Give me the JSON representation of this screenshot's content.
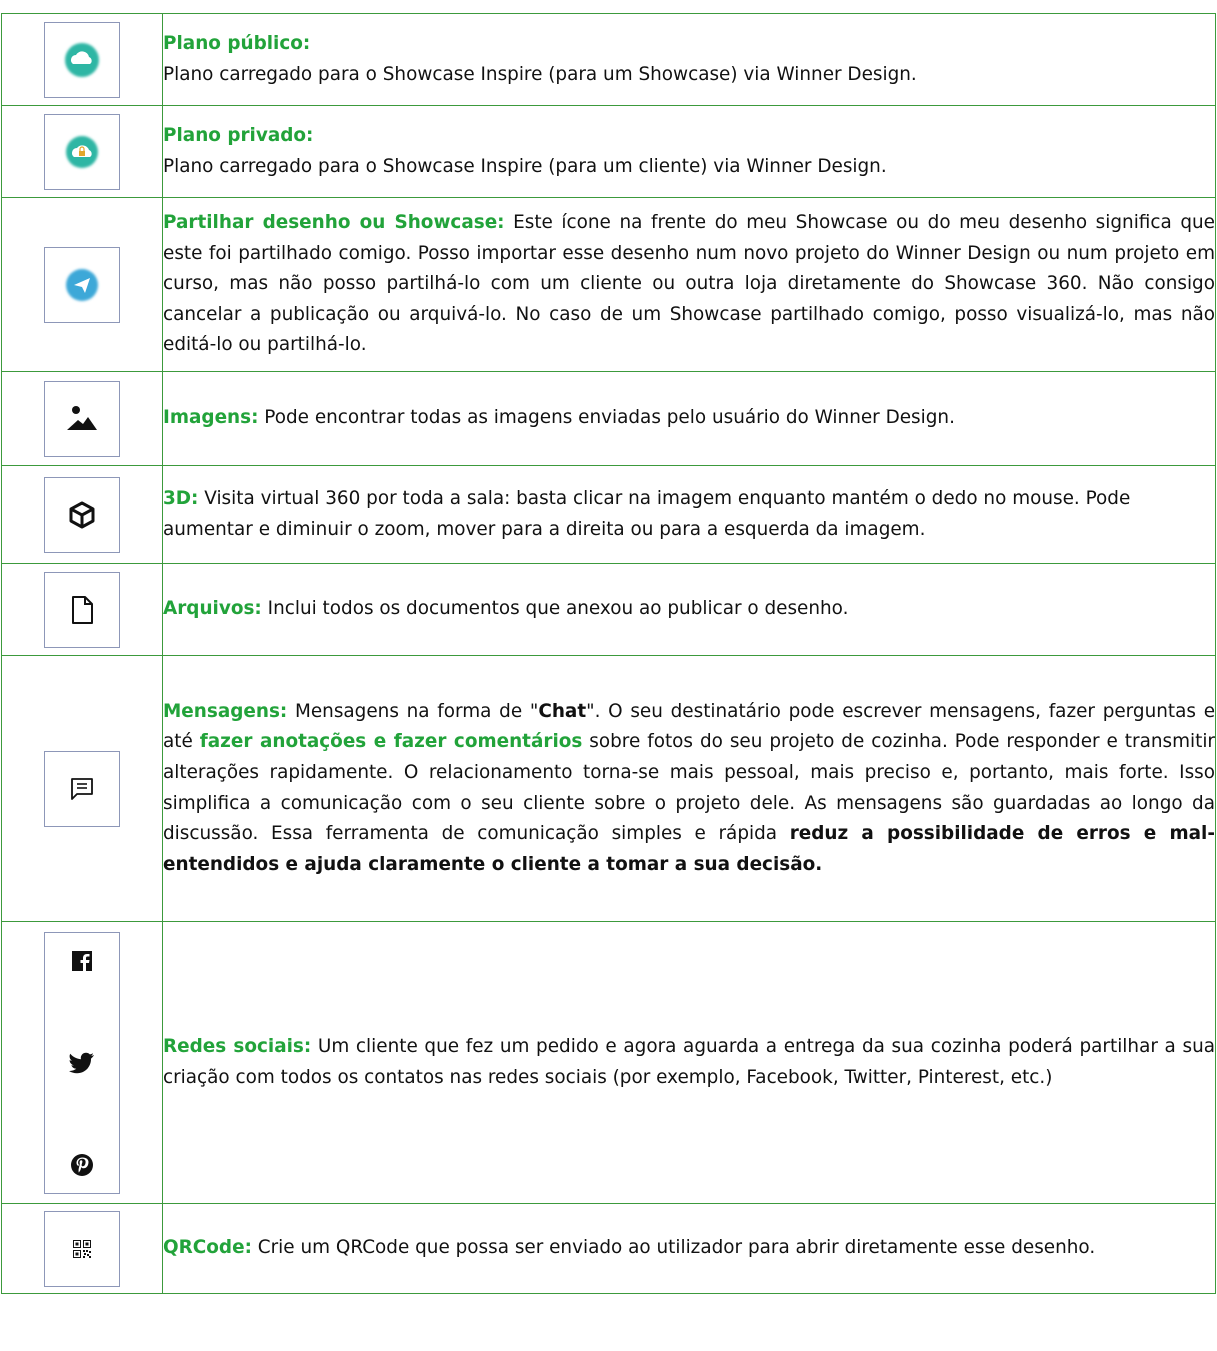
{
  "rows": [
    {
      "icon": "cloud-icon",
      "title": "Plano público:",
      "text": "Plano carregado para o Showcase Inspire (para um Showcase) via Winner Design."
    },
    {
      "icon": "private-cloud-lock-icon",
      "title": "Plano privado:",
      "text": "Plano carregado para o Showcase Inspire (para um cliente) via Winner Design."
    },
    {
      "icon": "share-paper-plane-icon",
      "title": "Partilhar  desenho ou Showcase:",
      "text": " Este ícone na frente do meu Showcase ou do meu desenho significa que este foi partilhado comigo. Posso importar esse desenho num novo projeto do Winner Design ou num projeto em curso, mas não posso partilhá-lo com um cliente ou outra loja diretamente do Showcase 360. Não consigo cancelar a publicação ou arquivá-lo. No caso de um Showcase partilhado comigo, posso visualizá-lo, mas não editá-lo ou partilhá-lo."
    },
    {
      "icon": "image-icon",
      "title": "Imagens:",
      "text": " Pode encontrar todas as imagens enviadas pelo usuário do Winner Design."
    },
    {
      "icon": "cube-3d-icon",
      "title": "3D:",
      "text": " Visita virtual 360 por toda a sala: basta clicar na imagem enquanto mantém o dedo no mouse. Pode aumentar e diminuir o zoom, mover para a direita ou para a esquerda da imagem."
    },
    {
      "icon": "file-icon",
      "title": "Arquivos:",
      "text": " Inclui todos os documentos que anexou ao publicar o desenho."
    },
    {
      "icon": "message-icon",
      "title": "Mensagens:",
      "text_a": " Mensagens na forma de \"",
      "chat": "Chat",
      "text_b": "\". O seu destinatário pode escrever mensagens, fazer perguntas e até ",
      "highlight": "fazer anotações e fazer comentários",
      "text_c": " sobre fotos do seu projeto de cozinha. Pode responder e transmitir alterações rapidamente. O relacionamento torna-se mais pessoal, mais preciso e, portanto, mais forte. Isso simplifica a comunicação com o seu cliente sobre o projeto dele. As mensagens são guardadas ao longo da discussão. Essa ferramenta de comunicação simples e rápida ",
      "bold_end": "reduz a possibilidade de erros e mal-entendidos e ajuda claramente o cliente a tomar a sua decisão."
    },
    {
      "icons": [
        "facebook-icon",
        "twitter-icon",
        "pinterest-icon"
      ],
      "title": "Redes sociais:",
      "text": " Um cliente que fez um pedido e agora aguarda a entrega da sua cozinha poderá partilhar a sua criação com todos os contatos nas redes sociais (por exemplo, Facebook, Twitter, Pinterest, etc.)"
    },
    {
      "icon": "qrcode-icon",
      "title": "QRCode:",
      "text": " Crie um QRCode que possa ser enviado ao utilizador para abrir diretamente esse desenho."
    }
  ],
  "colors": {
    "green": "#22a33a",
    "border": "#3c9a3c",
    "icon_blue": "#3ea8d8",
    "icon_teal": "#2fb6a4"
  }
}
